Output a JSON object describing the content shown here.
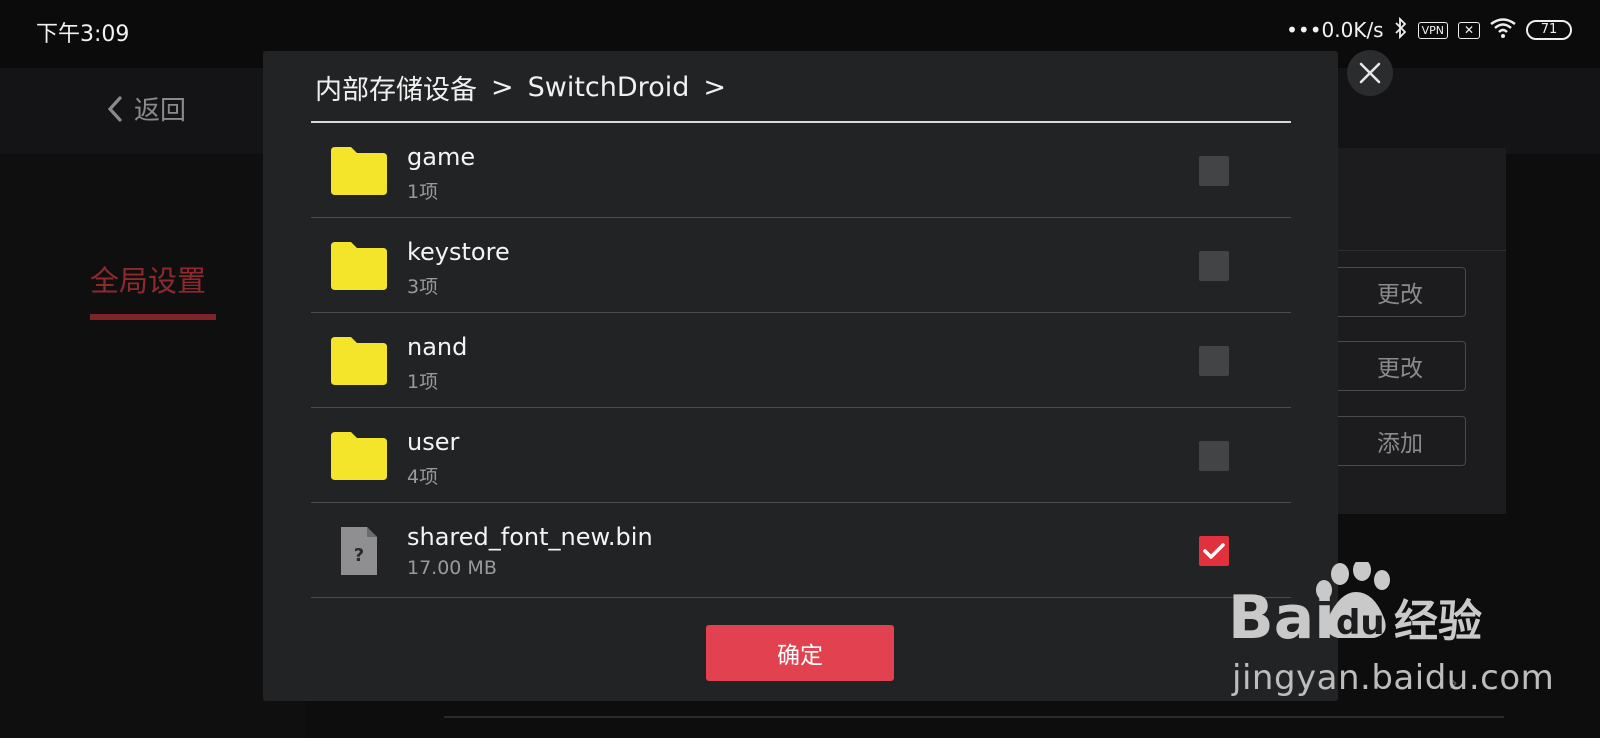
{
  "status_bar": {
    "time": "下午3:09",
    "network_speed": "•••0.0K/s",
    "vpn_label": "VPN",
    "battery_level": "71"
  },
  "top_bar": {
    "back_label": "返回"
  },
  "sidebar": {
    "active_item": "全局设置"
  },
  "background_buttons": {
    "change_1": "更改",
    "change_2": "更改",
    "add": "添加"
  },
  "dialog": {
    "breadcrumb": {
      "root": "内部存储设备",
      "separator": ">",
      "folder": "SwitchDroid"
    },
    "items": [
      {
        "name": "game",
        "meta": "1项",
        "type": "folder",
        "checked": false
      },
      {
        "name": "keystore",
        "meta": "3项",
        "type": "folder",
        "checked": false
      },
      {
        "name": "nand",
        "meta": "1项",
        "type": "folder",
        "checked": false
      },
      {
        "name": "user",
        "meta": "4项",
        "type": "folder",
        "checked": false
      },
      {
        "name": "shared_font_new.bin",
        "meta": "17.00 MB",
        "type": "unknown-file",
        "checked": true
      }
    ],
    "confirm_label": "确定"
  },
  "watermark": {
    "url": "jingyan.baidu.com"
  },
  "colors": {
    "accent_red": "#e2424f",
    "folder_yellow": "#f5e52a",
    "dialog_bg": "#222325",
    "sidebar_active": "#8e2a2e"
  }
}
